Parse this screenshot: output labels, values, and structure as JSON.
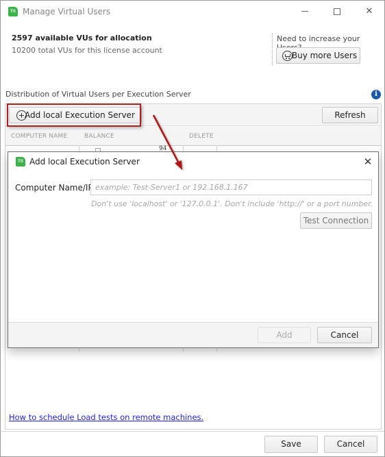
{
  "window": {
    "title": "Manage Virtual Users",
    "logo_text": "TS",
    "controls": {
      "minimize": "minimize",
      "maximize": "maximize",
      "close": "✕"
    }
  },
  "license": {
    "available": "2597 available VUs for allocation",
    "total": "10200 total VUs for this license account"
  },
  "buy": {
    "question": "Need to increase your Users?",
    "button_label": "Buy more Users"
  },
  "distribution": {
    "label": "Distribution of Virtual Users per Execution Server",
    "info_icon": "i",
    "add_button_label": "Add local Execution Server",
    "refresh_label": "Refresh",
    "columns": [
      "COMPUTER NAME",
      "BALANCE",
      "DELETE"
    ],
    "partial_value": "94"
  },
  "help_link": "How to schedule Load tests on remote machines.",
  "footer": {
    "save_label": "Save",
    "cancel_label": "Cancel"
  },
  "modal": {
    "logo_text": "TS",
    "title": "Add local Execution Server",
    "close": "✕",
    "field_label": "Computer Name/IP:",
    "field_value": "",
    "field_placeholder": "example: Test-Server1 or 192.168.1.167",
    "hint": "Don't use 'localhost' or '127.0.0.1'. Don't include 'http://' or a port number.",
    "test_label": "Test Connection",
    "add_label": "Add",
    "cancel_label": "Cancel"
  },
  "colors": {
    "accent_green": "#3bb34a",
    "highlight_red": "#b02020",
    "link_blue": "#1f1fdc",
    "info_blue": "#1a5aa6"
  }
}
